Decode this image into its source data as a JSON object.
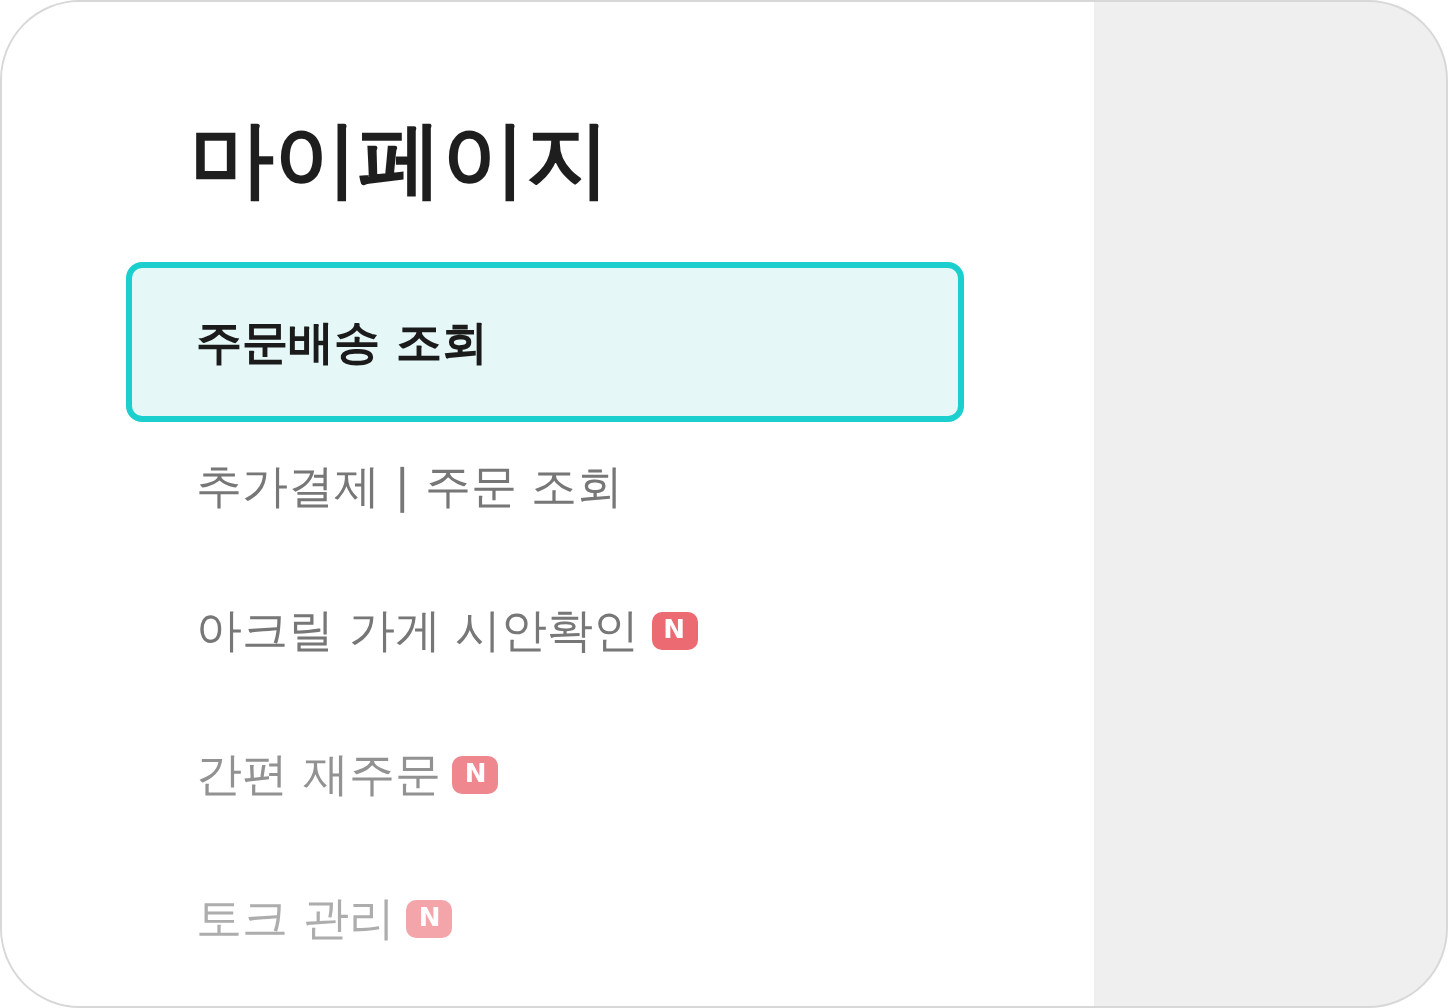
{
  "page_title": "마이페이지",
  "menu": [
    {
      "label": "주문배송 조회",
      "selected": true,
      "is_new": false
    },
    {
      "label": "추가결제 | 주문 조회",
      "selected": false,
      "is_new": false
    },
    {
      "label": "아크릴 가게 시안확인",
      "selected": false,
      "is_new": true,
      "badge": "N"
    },
    {
      "label": "간편 재주문",
      "selected": false,
      "is_new": true,
      "badge": "N"
    },
    {
      "label": "토크 관리",
      "selected": false,
      "is_new": true,
      "badge": "N"
    }
  ]
}
